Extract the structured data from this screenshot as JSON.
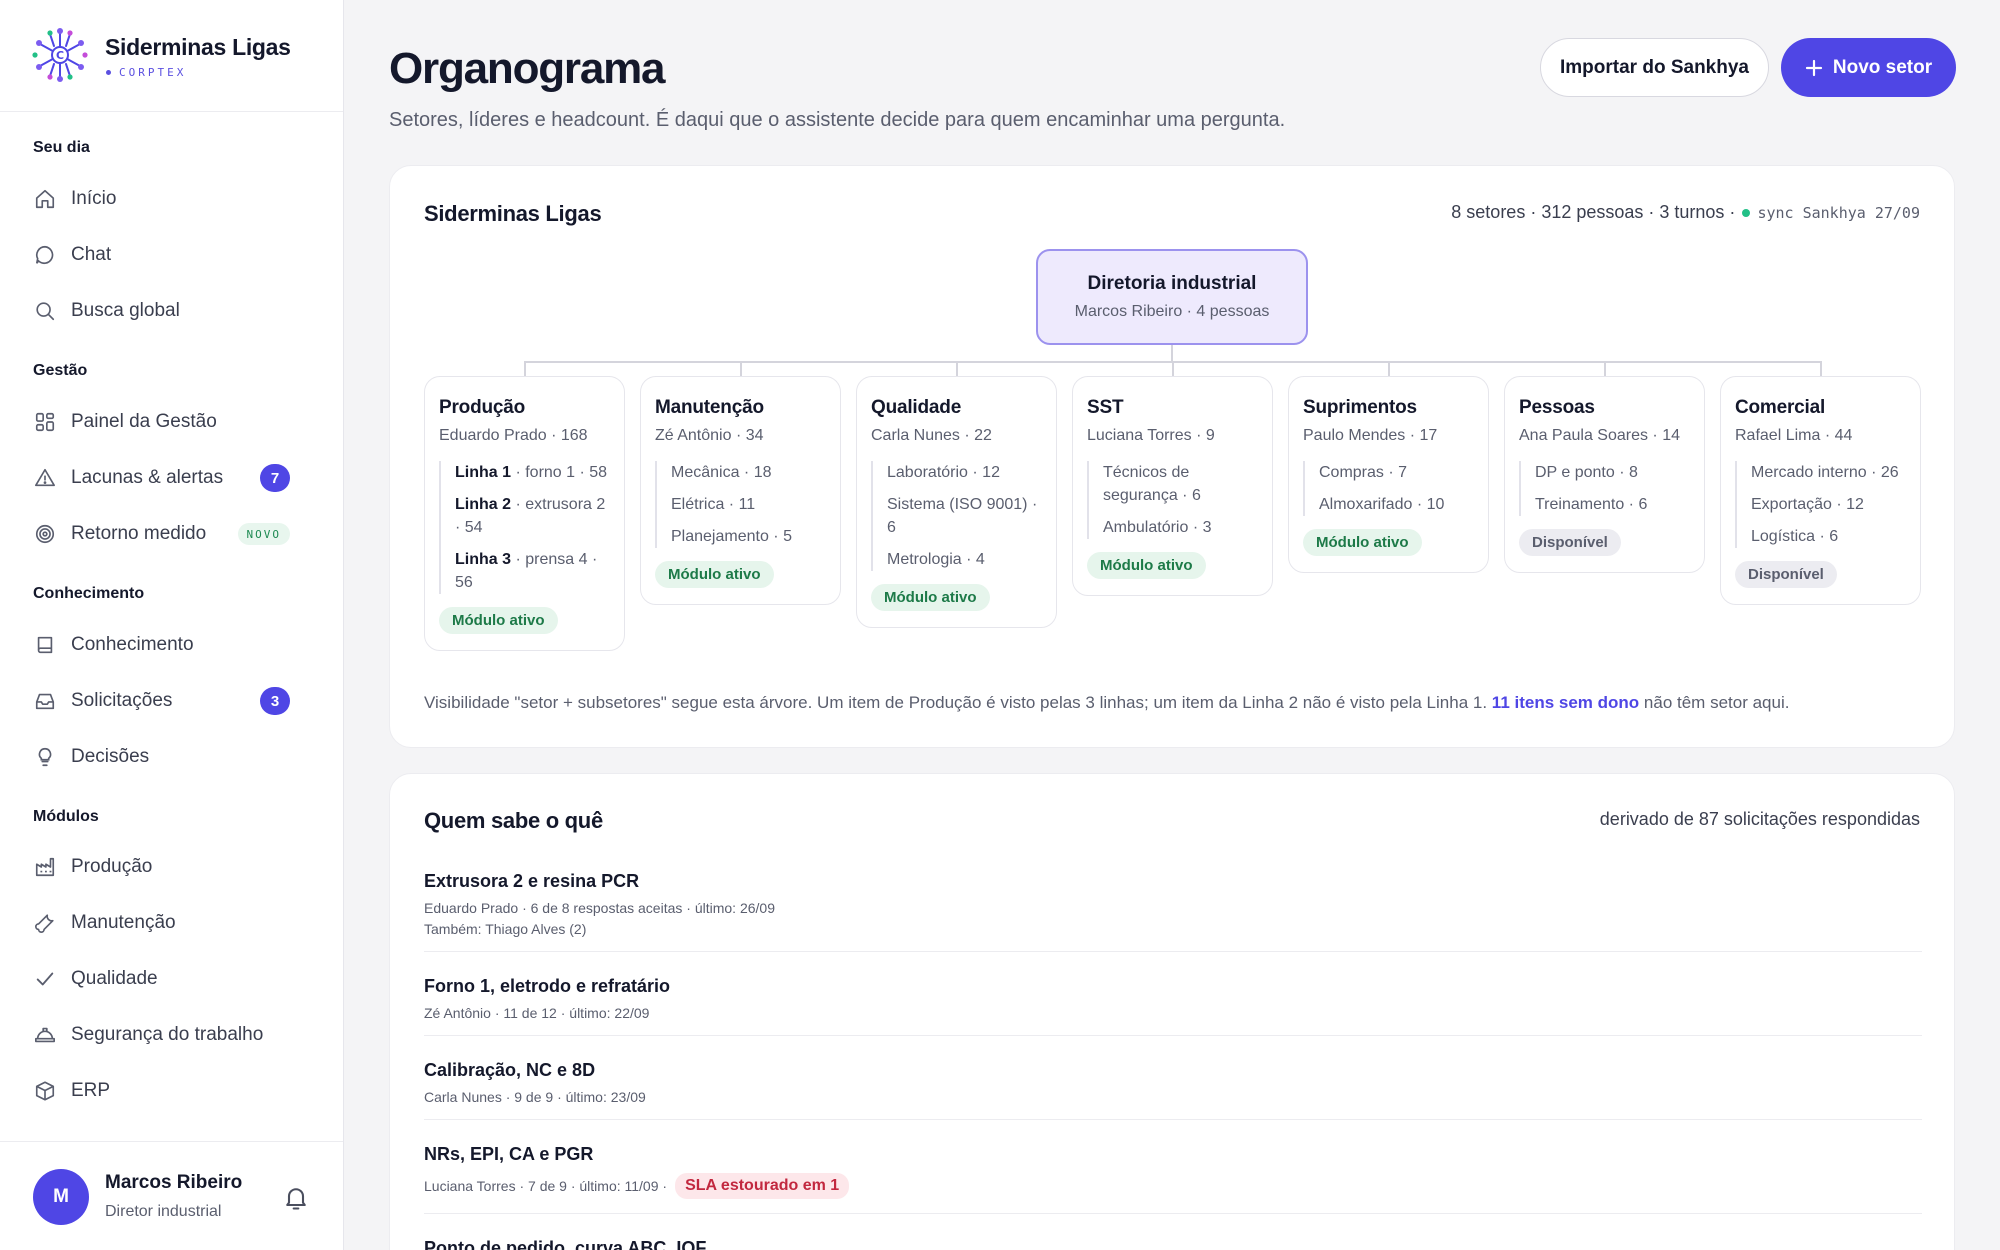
{
  "brand": {
    "name": "Siderminas Ligas",
    "sub": "CORPTEX"
  },
  "sidebar": {
    "sections": [
      {
        "title": "Seu dia",
        "items": [
          {
            "label": "Início",
            "icon": "home-icon"
          },
          {
            "label": "Chat",
            "icon": "chat-icon"
          },
          {
            "label": "Busca global",
            "icon": "search-icon"
          }
        ]
      },
      {
        "title": "Gestão",
        "items": [
          {
            "label": "Painel da Gestão",
            "icon": "dashboard-icon"
          },
          {
            "label": "Lacunas & alertas",
            "icon": "alert-icon",
            "badge": "7"
          },
          {
            "label": "Retorno medido",
            "icon": "target-icon",
            "tag": "NOVO"
          }
        ]
      },
      {
        "title": "Conhecimento",
        "items": [
          {
            "label": "Conhecimento",
            "icon": "book-icon"
          },
          {
            "label": "Solicitações",
            "icon": "inbox-icon",
            "badge": "3"
          },
          {
            "label": "Decisões",
            "icon": "lightbulb-icon"
          }
        ]
      },
      {
        "title": "Módulos",
        "items": [
          {
            "label": "Produção",
            "icon": "factory-icon"
          },
          {
            "label": "Manutenção",
            "icon": "wrench-icon"
          },
          {
            "label": "Qualidade",
            "icon": "check-icon"
          },
          {
            "label": "Segurança do trabalho",
            "icon": "helmet-icon"
          },
          {
            "label": "ERP",
            "icon": "cube-icon"
          }
        ]
      }
    ]
  },
  "user": {
    "initial": "M",
    "name": "Marcos Ribeiro",
    "role": "Diretor industrial"
  },
  "header": {
    "title": "Organograma",
    "subtitle": "Setores, líderes e headcount. É daqui que o assistente decide para quem encaminhar uma pergunta.",
    "import_label": "Importar do Sankhya",
    "new_label": "Novo setor"
  },
  "org": {
    "title": "Siderminas Ligas",
    "meta": "8 setores · 312 pessoas · 3 turnos ·",
    "sync": "sync Sankhya 27/09",
    "root": {
      "title": "Diretoria industrial",
      "sub": "Marcos Ribeiro · 4 pessoas"
    },
    "departments": [
      {
        "title": "Produção",
        "sub": "Eduardo Prado · 168",
        "subs": [
          {
            "name": "Linha 1",
            "detail": " · forno 1 · 58"
          },
          {
            "name": "Linha 2",
            "detail": " · extrusora 2 · 54"
          },
          {
            "name": "Linha 3",
            "detail": " · prensa 4 · 56"
          }
        ],
        "status": "Módulo ativo",
        "status_kind": "green"
      },
      {
        "title": "Manutenção",
        "sub": "Zé Antônio · 34",
        "subs": [
          {
            "name": "",
            "detail": "Mecânica · 18"
          },
          {
            "name": "",
            "detail": "Elétrica · 11"
          },
          {
            "name": "",
            "detail": "Planejamento · 5"
          }
        ],
        "status": "Módulo ativo",
        "status_kind": "green"
      },
      {
        "title": "Qualidade",
        "sub": "Carla Nunes · 22",
        "subs": [
          {
            "name": "",
            "detail": "Laboratório · 12"
          },
          {
            "name": "",
            "detail": "Sistema (ISO 9001) · 6"
          },
          {
            "name": "",
            "detail": "Metrologia · 4"
          }
        ],
        "status": "Módulo ativo",
        "status_kind": "green"
      },
      {
        "title": "SST",
        "sub": "Luciana Torres · 9",
        "subs": [
          {
            "name": "",
            "detail": "Técnicos de segurança · 6"
          },
          {
            "name": "",
            "detail": "Ambulatório · 3"
          }
        ],
        "status": "Módulo ativo",
        "status_kind": "green"
      },
      {
        "title": "Suprimentos",
        "sub": "Paulo Mendes · 17",
        "subs": [
          {
            "name": "",
            "detail": "Compras · 7"
          },
          {
            "name": "",
            "detail": "Almoxarifado · 10"
          }
        ],
        "status": "Módulo ativo",
        "status_kind": "green"
      },
      {
        "title": "Pessoas",
        "sub": "Ana Paula Soares · 14",
        "subs": [
          {
            "name": "",
            "detail": "DP e ponto · 8"
          },
          {
            "name": "",
            "detail": "Treinamento · 6"
          }
        ],
        "status": "Disponível",
        "status_kind": "gray"
      },
      {
        "title": "Comercial",
        "sub": "Rafael Lima · 44",
        "subs": [
          {
            "name": "",
            "detail": "Mercado interno · 26"
          },
          {
            "name": "",
            "detail": "Exportação · 12"
          },
          {
            "name": "",
            "detail": "Logística · 6"
          }
        ],
        "status": "Disponível",
        "status_kind": "gray"
      }
    ],
    "footnote": "Visibilidade \"setor + subsetores\" segue esta árvore. Um item de Produção é visto pelas 3 linhas; um item da Linha 2 não é visto pela Linha 1.",
    "footnote_link": "11 itens sem dono",
    "footnote_tail": "não têm setor aqui."
  },
  "knowledge": {
    "title": "Quem sabe o quê",
    "meta": "derivado de 87 solicitações respondidas",
    "items": [
      {
        "title": "Extrusora 2 e resina PCR",
        "meta": "Eduardo Prado · 6 de 8 respostas aceitas · último: 26/09",
        "extra": "Também: Thiago Alves (2)"
      },
      {
        "title": "Forno 1, eletrodo e refratário",
        "meta": "Zé Antônio · 11 de 12 · último: 22/09"
      },
      {
        "title": "Calibração, NC e 8D",
        "meta": "Carla Nunes · 9 de 9 · último: 23/09"
      },
      {
        "title": "NRs, EPI, CA e PGR",
        "meta": "Luciana Torres · 7 de 9 · último: 11/09 ·",
        "alert": "SLA estourado em 1"
      },
      {
        "title": "Ponto de pedido, curva ABC, IQF",
        "meta": ""
      }
    ]
  },
  "colors": {
    "accent": "#4f46e5",
    "success": "#22c087",
    "danger": "#c2283f"
  }
}
